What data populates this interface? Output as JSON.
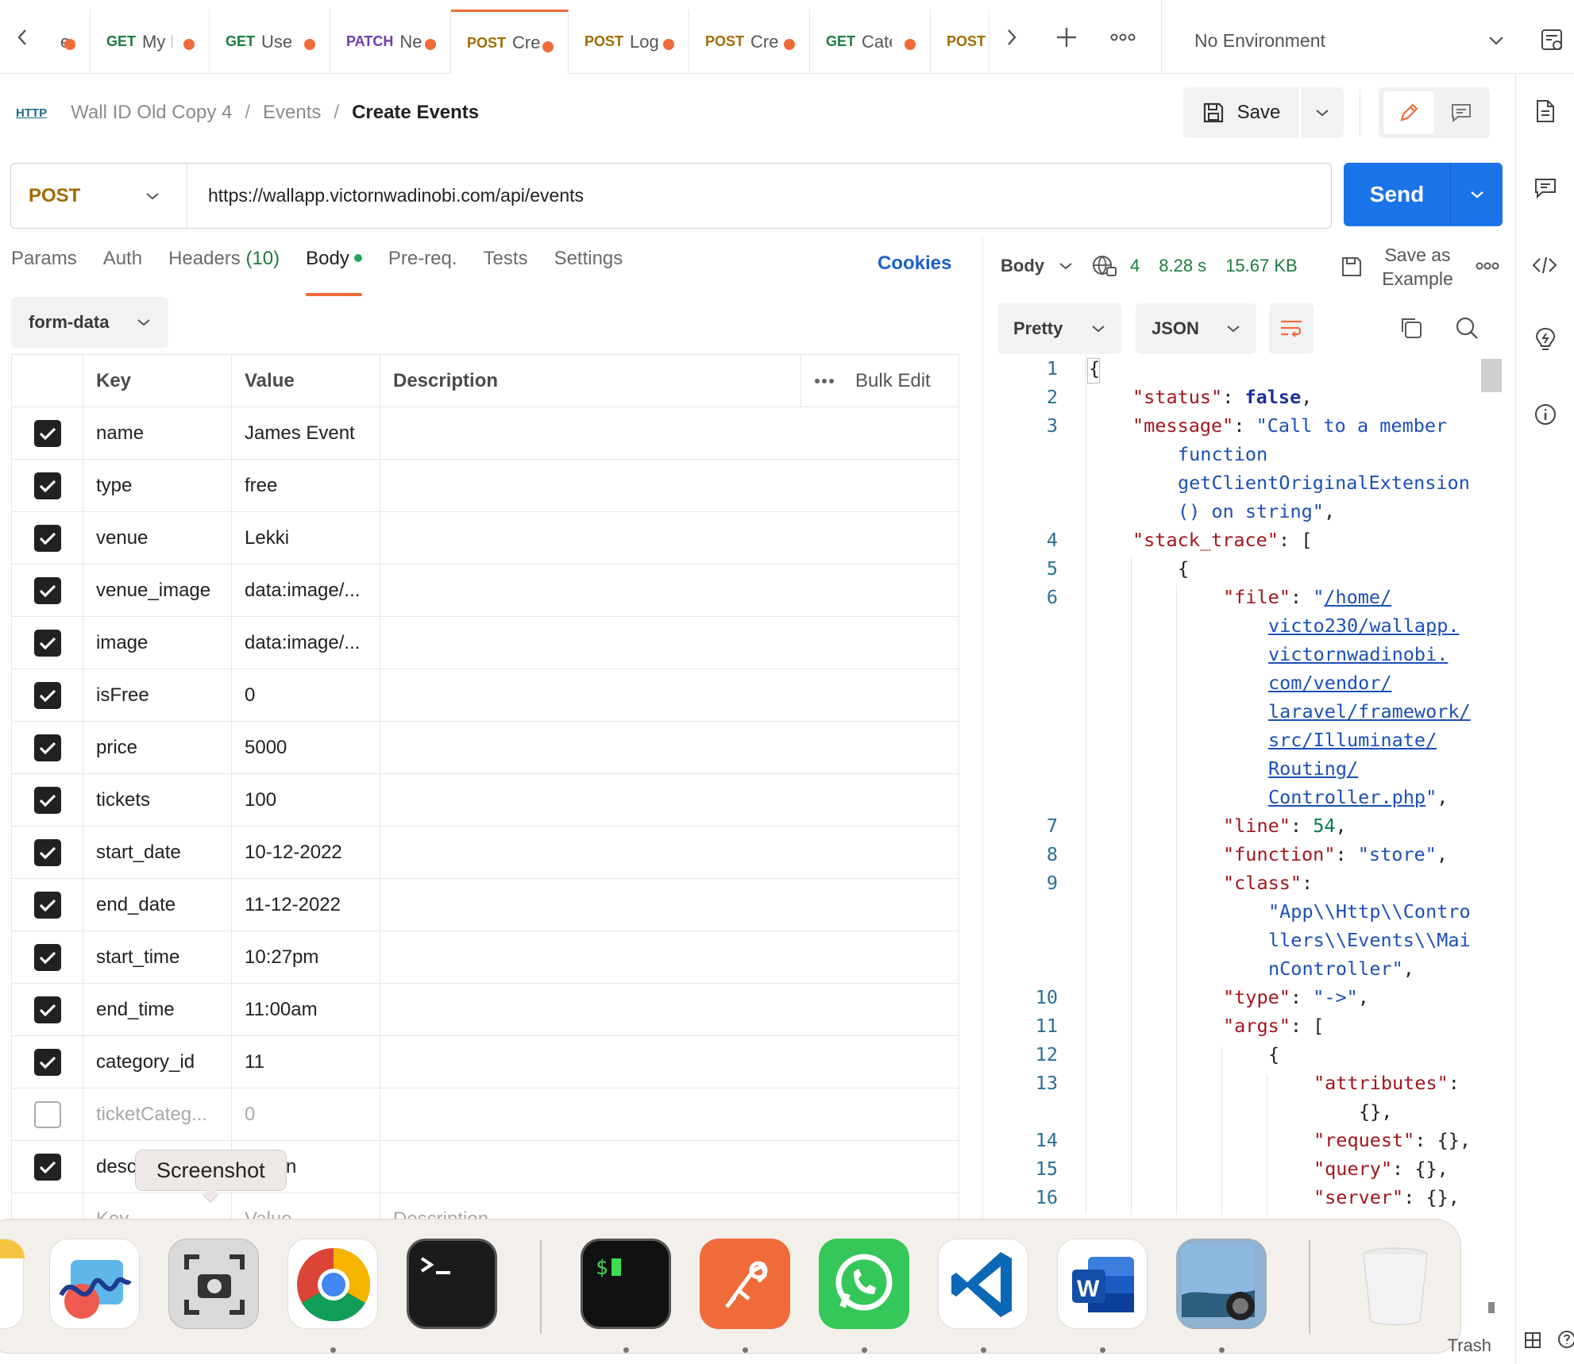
{
  "tabs": [
    {
      "method": "",
      "name": "el"
    },
    {
      "method": "GET",
      "name": "My I"
    },
    {
      "method": "GET",
      "name": "User"
    },
    {
      "method": "PATCH",
      "name": "Ne"
    },
    {
      "method": "POST",
      "name": "Cre",
      "active": true
    },
    {
      "method": "POST",
      "name": "Log"
    },
    {
      "method": "POST",
      "name": "Cre"
    },
    {
      "method": "GET",
      "name": "Cate"
    },
    {
      "method": "POST",
      "name": ""
    }
  ],
  "environment": {
    "label": "No Environment"
  },
  "breadcrumb": {
    "icon_text": "HTTP",
    "collection": "Wall ID Old Copy 4",
    "folder": "Events",
    "request": "Create Events"
  },
  "toolbar": {
    "save_label": "Save"
  },
  "request": {
    "method": "POST",
    "url": "https://wallapp.victornwadinobi.com/api/events",
    "send_label": "Send"
  },
  "req_tabs": {
    "params": "Params",
    "auth": "Auth",
    "headers": "Headers",
    "headers_count": "(10)",
    "body": "Body",
    "prereq": "Pre-req.",
    "tests": "Tests",
    "settings": "Settings",
    "cookies": "Cookies"
  },
  "body_mode": "form-data",
  "table": {
    "headers": {
      "key": "Key",
      "value": "Value",
      "description": "Description",
      "bulk_edit": "Bulk Edit"
    },
    "rows": [
      {
        "key": "name",
        "value": "James Event",
        "checked": true
      },
      {
        "key": "type",
        "value": "free",
        "checked": true
      },
      {
        "key": "venue",
        "value": "Lekki",
        "checked": true
      },
      {
        "key": "venue_image",
        "value": "data:image/...",
        "checked": true
      },
      {
        "key": "image",
        "value": "data:image/...",
        "checked": true
      },
      {
        "key": "isFree",
        "value": "0",
        "checked": true
      },
      {
        "key": "price",
        "value": "5000",
        "checked": true
      },
      {
        "key": "tickets",
        "value": "100",
        "checked": true
      },
      {
        "key": "start_date",
        "value": "10-12-2022",
        "checked": true
      },
      {
        "key": "end_date",
        "value": "11-12-2022",
        "checked": true
      },
      {
        "key": "start_time",
        "value": "10:27pm",
        "checked": true
      },
      {
        "key": "end_time",
        "value": "11:00am",
        "checked": true
      },
      {
        "key": "category_id",
        "value": "11",
        "checked": true
      },
      {
        "key": "ticketCateg...",
        "value": "0",
        "checked": false
      },
      {
        "key": "desc",
        "value": "ription",
        "checked": true
      }
    ],
    "placeholder": {
      "key": "Key",
      "value": "Value",
      "description": "Description"
    }
  },
  "response": {
    "body_label": "Body",
    "status_code": "4",
    "time": "8.28 s",
    "size": "15.67 KB",
    "save_example": "Save as Example",
    "format": "Pretty",
    "language": "JSON"
  },
  "code": {
    "line_numbers": [
      "1",
      "2",
      "3",
      "4",
      "5",
      "6",
      "7",
      "8",
      "9",
      "10",
      "11",
      "12",
      "13",
      "14",
      "15",
      "16"
    ]
  },
  "tooltip": "Screenshot",
  "dock": {
    "trash_label": "Trash"
  },
  "colors": {
    "accent": "#ef6b3a",
    "primary": "#1a73e8",
    "get": "#1b7d3e",
    "post": "#a26a00",
    "patch": "#6c3bb0"
  }
}
